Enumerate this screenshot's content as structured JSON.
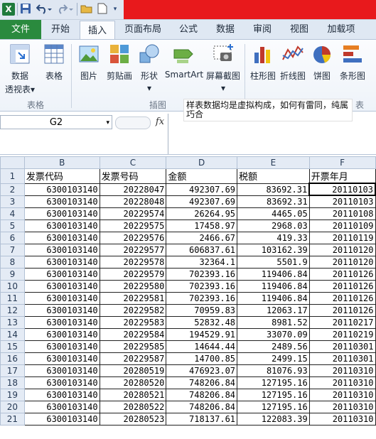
{
  "titlebar": {
    "app_icon": "excel-icon",
    "quick_access": [
      "save-icon",
      "undo-icon",
      "redo-icon",
      "open-folder-icon",
      "new-file-icon",
      "customize-icon"
    ]
  },
  "tabs": [
    "文件",
    "开始",
    "插入",
    "页面布局",
    "公式",
    "数据",
    "审阅",
    "视图",
    "加载项"
  ],
  "active_tab": "插入",
  "ribbon": {
    "groups": [
      {
        "label": "表格",
        "buttons": [
          {
            "label": "数据",
            "label2": "透视表▾",
            "icon": "pivot-table-icon"
          },
          {
            "label": "表格",
            "icon": "table-icon"
          }
        ]
      },
      {
        "label": "插图",
        "buttons": [
          {
            "label": "图片",
            "icon": "picture-icon"
          },
          {
            "label": "剪贴画",
            "icon": "clipart-icon"
          },
          {
            "label": "形状",
            "label2": "▾",
            "icon": "shapes-icon"
          },
          {
            "label": "SmartArt",
            "icon": "smartart-icon"
          },
          {
            "label": "屏幕截图",
            "label2": "▾",
            "icon": "screenshot-icon"
          }
        ]
      },
      {
        "label": "表",
        "buttons": [
          {
            "label": "柱形图",
            "icon": "column-chart-icon"
          },
          {
            "label": "折线图",
            "icon": "line-chart-icon"
          },
          {
            "label": "饼图",
            "icon": "pie-chart-icon"
          },
          {
            "label": "条形图",
            "icon": "bar-chart-icon"
          }
        ]
      }
    ]
  },
  "tooltip": "样表数据均是虚拟构成，如何有雷同，纯属巧合",
  "formula_bar": {
    "name_box": "G2",
    "fx": "fx",
    "value": ""
  },
  "columns": [
    "B",
    "C",
    "D",
    "E",
    "F"
  ],
  "rows": [
    {
      "n": "1",
      "cells": [
        "发票代码",
        "发票号码",
        "金额",
        "税额",
        "开票年月"
      ]
    },
    {
      "n": "2",
      "cells": [
        "6300103140",
        "20228047",
        "492307.69",
        "83692.31",
        "20110103"
      ]
    },
    {
      "n": "3",
      "cells": [
        "6300103140",
        "20228048",
        "492307.69",
        "83692.31",
        "20110103"
      ]
    },
    {
      "n": "4",
      "cells": [
        "6300103140",
        "20229574",
        "26264.95",
        "4465.05",
        "20110108"
      ]
    },
    {
      "n": "5",
      "cells": [
        "6300103140",
        "20229575",
        "17458.97",
        "2968.03",
        "20110109"
      ]
    },
    {
      "n": "6",
      "cells": [
        "6300103140",
        "20229576",
        "2466.67",
        "419.33",
        "20110119"
      ]
    },
    {
      "n": "7",
      "cells": [
        "6300103140",
        "20229577",
        "606837.61",
        "103162.39",
        "20110120"
      ]
    },
    {
      "n": "8",
      "cells": [
        "6300103140",
        "20229578",
        "32364.1",
        "5501.9",
        "20110120"
      ]
    },
    {
      "n": "9",
      "cells": [
        "6300103140",
        "20229579",
        "702393.16",
        "119406.84",
        "20110126"
      ]
    },
    {
      "n": "10",
      "cells": [
        "6300103140",
        "20229580",
        "702393.16",
        "119406.84",
        "20110126"
      ]
    },
    {
      "n": "11",
      "cells": [
        "6300103140",
        "20229581",
        "702393.16",
        "119406.84",
        "20110126"
      ]
    },
    {
      "n": "12",
      "cells": [
        "6300103140",
        "20229582",
        "70959.83",
        "12063.17",
        "20110126"
      ]
    },
    {
      "n": "13",
      "cells": [
        "6300103140",
        "20229583",
        "52832.48",
        "8981.52",
        "20110217"
      ]
    },
    {
      "n": "14",
      "cells": [
        "6300103140",
        "20229584",
        "194529.91",
        "33070.09",
        "20110219"
      ]
    },
    {
      "n": "15",
      "cells": [
        "6300103140",
        "20229585",
        "14644.44",
        "2489.56",
        "20110301"
      ]
    },
    {
      "n": "16",
      "cells": [
        "6300103140",
        "20229587",
        "14700.85",
        "2499.15",
        "20110301"
      ]
    },
    {
      "n": "17",
      "cells": [
        "6300103140",
        "20280519",
        "476923.07",
        "81076.93",
        "20110310"
      ]
    },
    {
      "n": "18",
      "cells": [
        "6300103140",
        "20280520",
        "748206.84",
        "127195.16",
        "20110310"
      ]
    },
    {
      "n": "19",
      "cells": [
        "6300103140",
        "20280521",
        "748206.84",
        "127195.16",
        "20110310"
      ]
    },
    {
      "n": "20",
      "cells": [
        "6300103140",
        "20280522",
        "748206.84",
        "127195.16",
        "20110310"
      ]
    },
    {
      "n": "21",
      "cells": [
        "6300103140",
        "20280523",
        "718137.61",
        "122083.39",
        "20110310"
      ]
    }
  ]
}
